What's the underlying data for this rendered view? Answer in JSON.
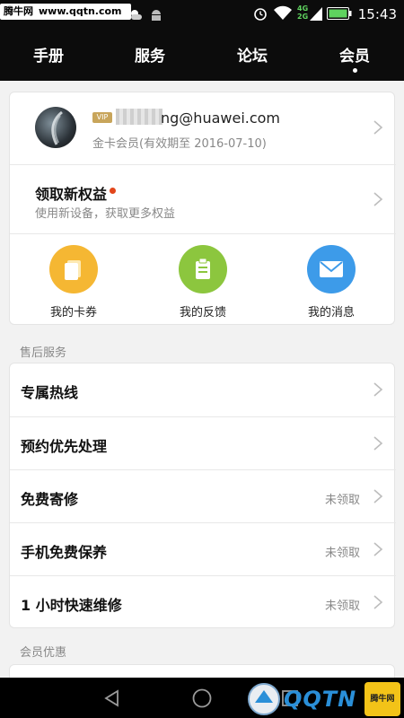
{
  "statusbar": {
    "watermark_name": "腾牛网",
    "watermark_url": "www.qqtn.com",
    "network_top": "4G",
    "network_bottom": "2G",
    "time": "15:43"
  },
  "tabs": [
    {
      "label": "手册",
      "active": false
    },
    {
      "label": "服务",
      "active": false
    },
    {
      "label": "论坛",
      "active": false
    },
    {
      "label": "会员",
      "active": true
    }
  ],
  "profile": {
    "vip_label": "VIP",
    "email_visible": "ng@huawei.com",
    "member_status": "金卡会员(有效期至 2016-07-10)"
  },
  "benefits": {
    "title": "领取新权益",
    "subtitle": "使用新设备，获取更多权益"
  },
  "shortcuts": [
    {
      "label": "我的卡券",
      "icon": "coupon-icon",
      "color": "#f5b733"
    },
    {
      "label": "我的反馈",
      "icon": "feedback-icon",
      "color": "#8cc63e"
    },
    {
      "label": "我的消息",
      "icon": "message-icon",
      "color": "#3d9be9"
    }
  ],
  "after_sales": {
    "section_title": "售后服务",
    "items": [
      {
        "label": "专属热线",
        "status": ""
      },
      {
        "label": "预约优先处理",
        "status": ""
      },
      {
        "label": "免费寄修",
        "status": "未领取"
      },
      {
        "label": "手机免费保养",
        "status": "未领取"
      },
      {
        "label": "1 小时快速维修",
        "status": "未领取"
      }
    ]
  },
  "member_offers": {
    "section_title": "会员优惠"
  },
  "watermark_bottom": {
    "brand": "QQTN",
    "badge": "腾牛网"
  },
  "colors": {
    "accent_red": "#e2461b",
    "topbar": "#0c0c0c",
    "vip_gold": "#c8a55b"
  }
}
